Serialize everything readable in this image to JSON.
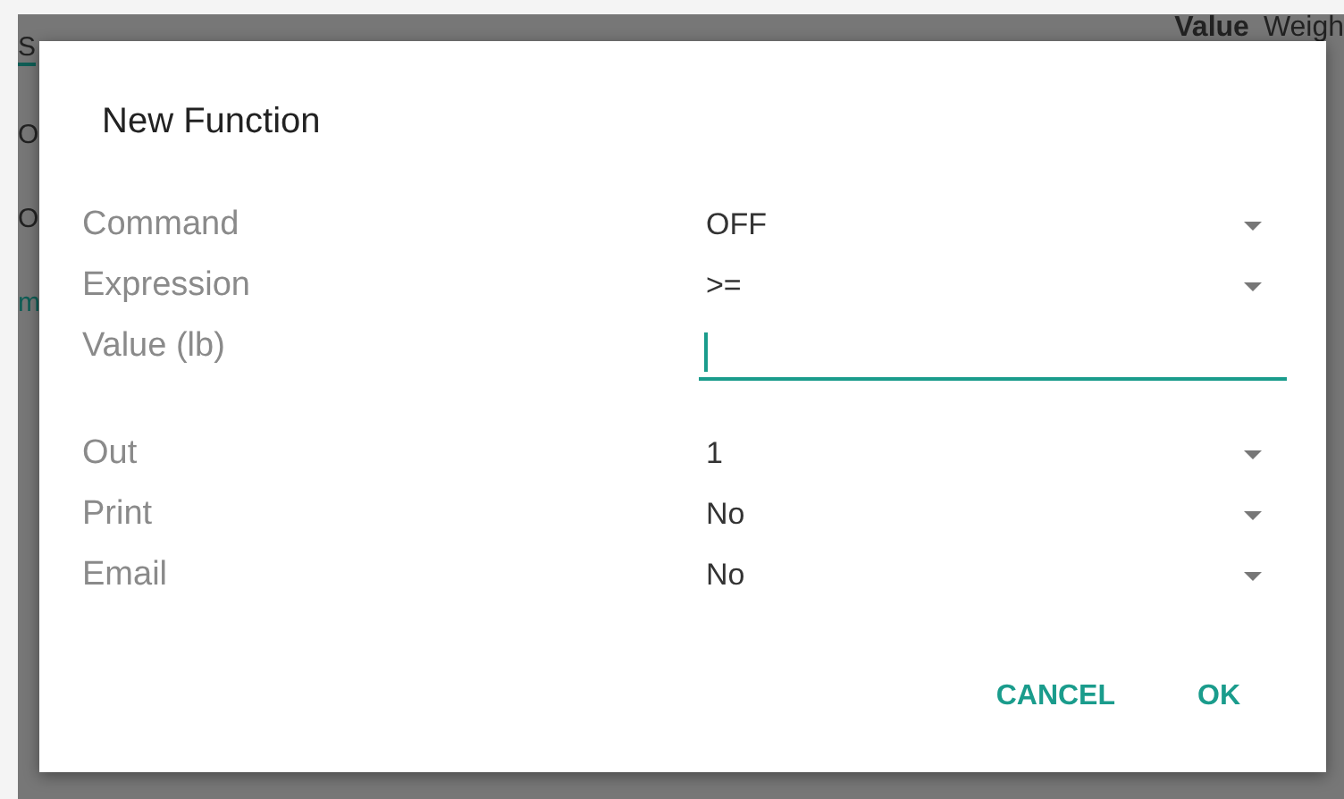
{
  "background": {
    "header": [
      {
        "text": "Value",
        "kind": "bold"
      },
      {
        "text": "Weigh",
        "kind": "plain"
      }
    ],
    "side_texts": [
      {
        "text": "S",
        "kind": "tab"
      },
      {
        "text": "O",
        "kind": "plain"
      },
      {
        "text": "O",
        "kind": "plain"
      },
      {
        "text": "m",
        "kind": "link"
      }
    ]
  },
  "dialog": {
    "title": "New Function",
    "fields": [
      {
        "label": "Command",
        "kind": "dropdown",
        "value": "OFF"
      },
      {
        "label": "Expression",
        "kind": "dropdown",
        "value": ">="
      },
      {
        "label": "Value (lb)",
        "kind": "text",
        "focused": true
      },
      {
        "label": "Out",
        "kind": "dropdown",
        "value": "1"
      },
      {
        "label": "Print",
        "kind": "dropdown",
        "value": "No"
      },
      {
        "label": "Email",
        "kind": "dropdown",
        "value": "No"
      }
    ],
    "buttons": [
      "CANCEL",
      "OK"
    ]
  }
}
